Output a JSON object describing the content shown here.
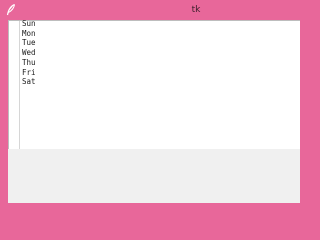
{
  "window": {
    "title": "tk",
    "frame_color": "#e8679a",
    "icon": "feather-icon"
  },
  "listbox": {
    "items": [
      "Sun",
      "Mon",
      "Tue",
      "Wed",
      "Thu",
      "Fri",
      "Sat"
    ]
  }
}
